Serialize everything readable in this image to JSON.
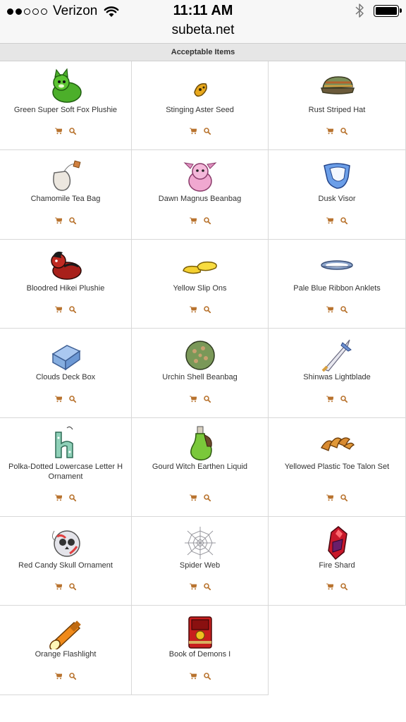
{
  "status_bar": {
    "carrier": "Verizon",
    "time": "11:11 AM",
    "signal_bars_filled": 2,
    "signal_bars_total": 5,
    "icons": [
      "wifi-icon",
      "bluetooth-icon",
      "battery-icon"
    ]
  },
  "browser": {
    "url": "subeta.net"
  },
  "section": {
    "title": "Acceptable Items"
  },
  "colors": {
    "action_icon": "#b8732e",
    "header_bg": "#e6e6e6",
    "grid_border": "#d8d8d8"
  },
  "items": [
    {
      "name": "Green Super Soft Fox Plushie",
      "icon": "fox-plushie-icon"
    },
    {
      "name": "Stinging Aster Seed",
      "icon": "seed-icon"
    },
    {
      "name": "Rust Striped Hat",
      "icon": "hat-icon"
    },
    {
      "name": "Chamomile Tea Bag",
      "icon": "tea-bag-icon"
    },
    {
      "name": "Dawn Magnus Beanbag",
      "icon": "beanbag-icon"
    },
    {
      "name": "Dusk Visor",
      "icon": "visor-icon"
    },
    {
      "name": "Bloodred Hikei Plushie",
      "icon": "hikei-plushie-icon"
    },
    {
      "name": "Yellow Slip Ons",
      "icon": "slippers-icon"
    },
    {
      "name": "Pale Blue Ribbon Anklets",
      "icon": "ribbon-icon"
    },
    {
      "name": "Clouds Deck Box",
      "icon": "deck-box-icon"
    },
    {
      "name": "Urchin Shell Beanbag",
      "icon": "urchin-icon"
    },
    {
      "name": "Shinwas Lightblade",
      "icon": "blade-icon"
    },
    {
      "name": "Polka-Dotted Lowercase Letter H Ornament",
      "icon": "letter-h-ornament-icon"
    },
    {
      "name": "Gourd Witch Earthen Liquid",
      "icon": "potion-icon"
    },
    {
      "name": "Yellowed Plastic Toe Talon Set",
      "icon": "talons-icon"
    },
    {
      "name": "Red Candy Skull Ornament",
      "icon": "skull-ornament-icon"
    },
    {
      "name": "Spider Web",
      "icon": "spider-web-icon"
    },
    {
      "name": "Fire Shard",
      "icon": "fire-shard-icon"
    },
    {
      "name": "Orange Flashlight",
      "icon": "flashlight-icon"
    },
    {
      "name": "Book of Demons I",
      "icon": "book-icon"
    }
  ],
  "item_actions": [
    "cart-icon",
    "magnifier-icon"
  ]
}
